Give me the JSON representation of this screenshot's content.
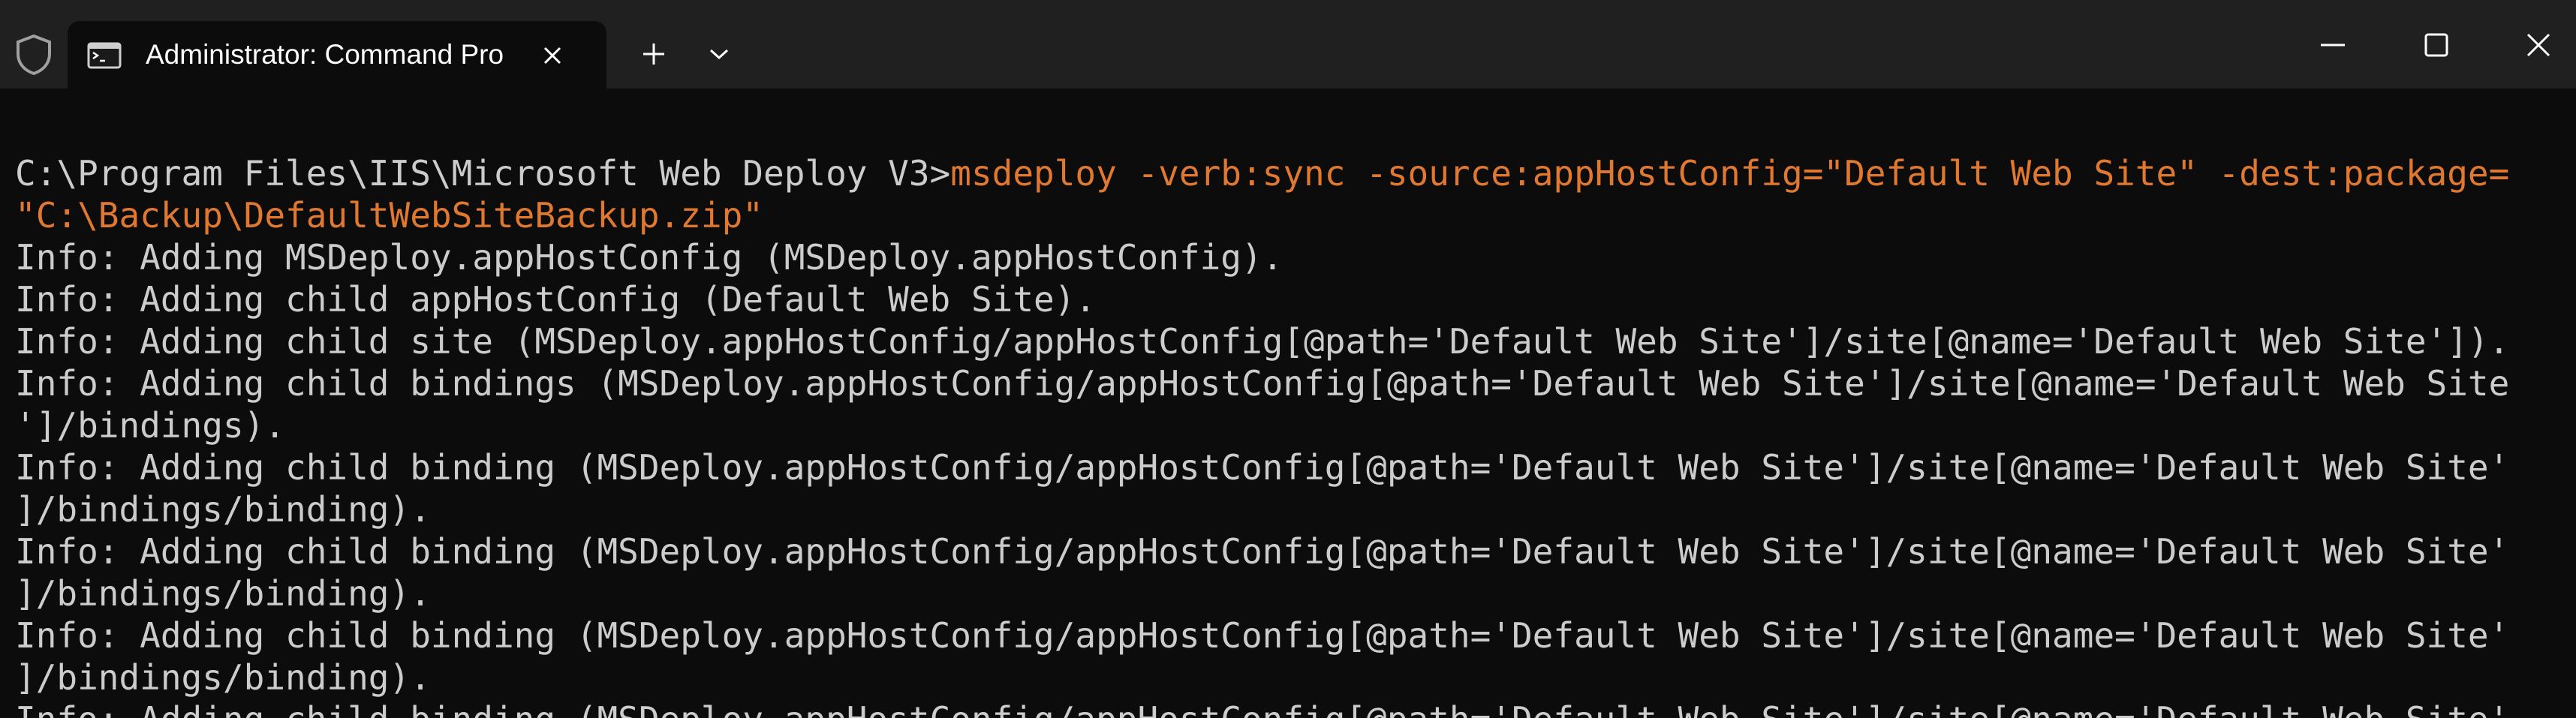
{
  "window": {
    "tab_title": "Administrator: Command Pro",
    "icons": {
      "shield": "shield-icon",
      "tab": "command-prompt-icon",
      "close_tab": "close-icon",
      "new_tab": "plus-icon",
      "dropdown": "chevron-down-icon",
      "minimize": "minimize-icon",
      "maximize": "maximize-icon",
      "close_window": "close-icon"
    }
  },
  "terminal": {
    "prompt": "C:\\Program Files\\IIS\\Microsoft Web Deploy V3>",
    "command_line_1": "msdeploy -verb:sync -source:appHostConfig=\"Default Web Site\" -dest:package=",
    "command_line_2": "\"C:\\Backup\\DefaultWebSiteBackup.zip\"",
    "output": [
      "Info: Adding MSDeploy.appHostConfig (MSDeploy.appHostConfig).",
      "Info: Adding child appHostConfig (Default Web Site).",
      "Info: Adding child site (MSDeploy.appHostConfig/appHostConfig[@path='Default Web Site']/site[@name='Default Web Site']).",
      "Info: Adding child bindings (MSDeploy.appHostConfig/appHostConfig[@path='Default Web Site']/site[@name='Default Web Site",
      "']/bindings).",
      "Info: Adding child binding (MSDeploy.appHostConfig/appHostConfig[@path='Default Web Site']/site[@name='Default Web Site'",
      "]/bindings/binding).",
      "Info: Adding child binding (MSDeploy.appHostConfig/appHostConfig[@path='Default Web Site']/site[@name='Default Web Site'",
      "]/bindings/binding).",
      "Info: Adding child binding (MSDeploy.appHostConfig/appHostConfig[@path='Default Web Site']/site[@name='Default Web Site'",
      "]/bindings/binding).",
      "Info: Adding child binding (MSDeploy.appHostConfig/appHostConfig[@path='Default Web Site']/site[@name='Default Web Site'"
    ],
    "colors": {
      "background": "#0c0c0c",
      "text": "#cccccc",
      "command": "#e07830",
      "titlebar": "#202020"
    }
  }
}
